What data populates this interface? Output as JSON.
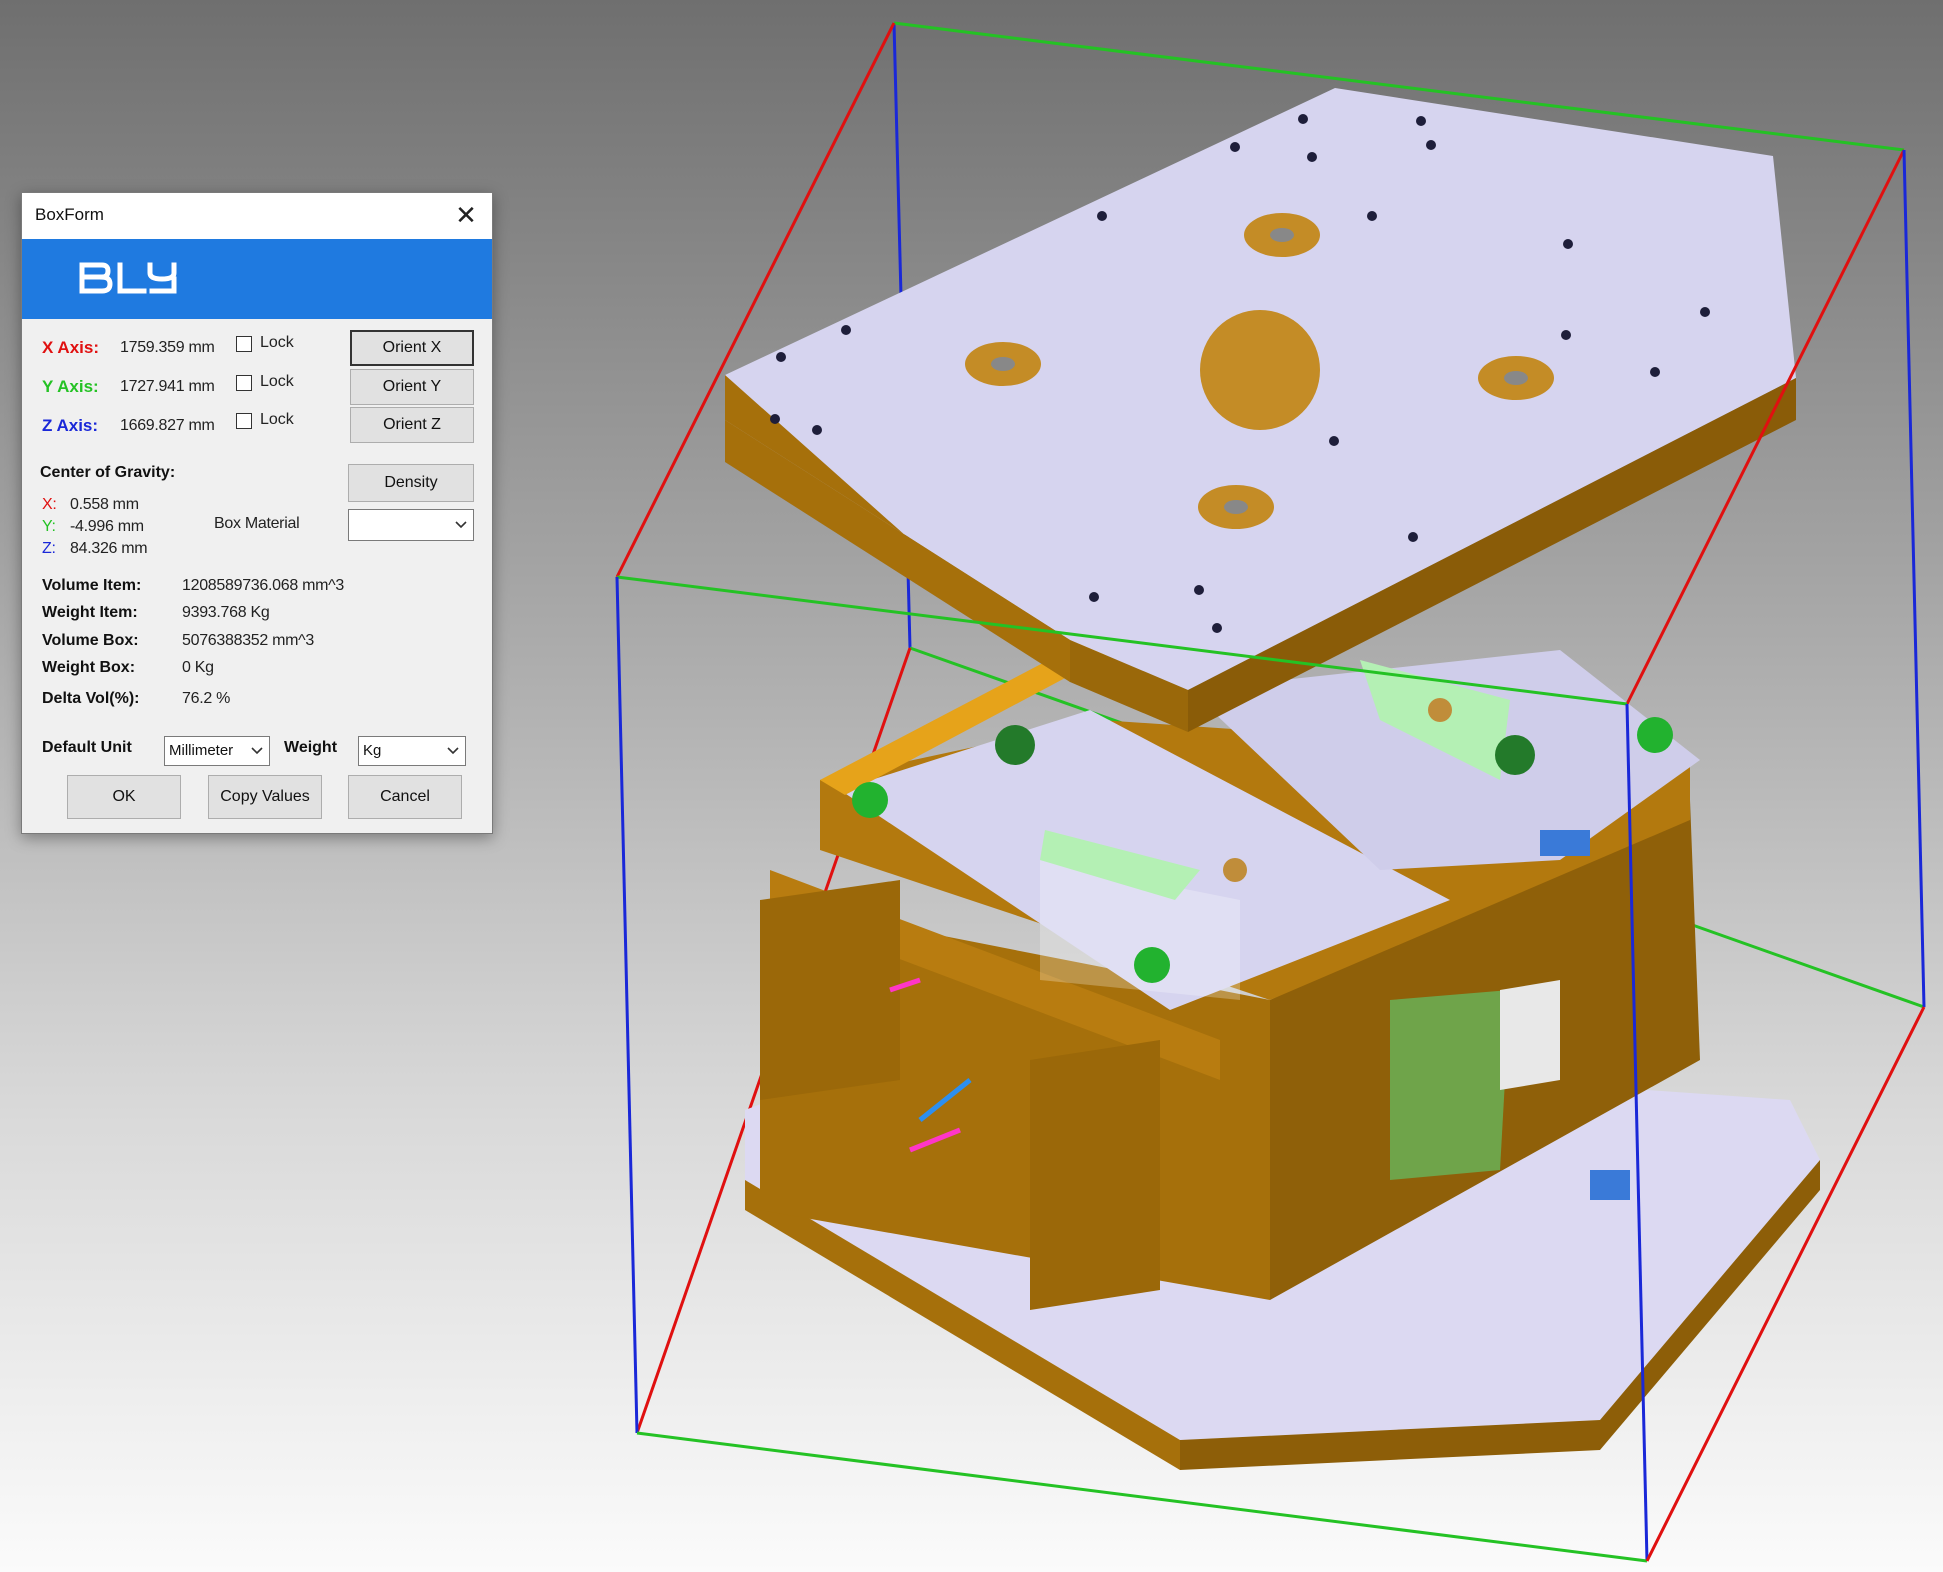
{
  "window": {
    "title": "BoxForm",
    "logo_text": "BLY"
  },
  "axes": [
    {
      "label": "X Axis:",
      "value": "1759.359 mm",
      "lock_label": "Lock",
      "orient_label": "Orient X",
      "color": "#e01010"
    },
    {
      "label": "Y Axis:",
      "value": "1727.941 mm",
      "lock_label": "Lock",
      "orient_label": "Orient Y",
      "color": "#24c224"
    },
    {
      "label": "Z Axis:",
      "value": "1669.827 mm",
      "lock_label": "Lock",
      "orient_label": "Orient Z",
      "color": "#1a28d8"
    }
  ],
  "gravity": {
    "title": "Center of Gravity:",
    "x_label": "X:",
    "x_value": "0.558 mm",
    "y_label": "Y:",
    "y_value": "-4.996 mm",
    "z_label": "Z:",
    "z_value": "84.326 mm"
  },
  "density_label": "Density",
  "box_material": {
    "label": "Box Material",
    "selected": ""
  },
  "stats": [
    {
      "label": "Volume Item:",
      "value": "1208589736.068 mm^3"
    },
    {
      "label": "Weight Item:",
      "value": "9393.768 Kg"
    },
    {
      "label": "Volume Box:",
      "value": "5076388352 mm^3"
    },
    {
      "label": "Weight Box:",
      "value": "0 Kg"
    },
    {
      "label": "Delta Vol(%):",
      "value": "76.2 %"
    }
  ],
  "units": {
    "default_label": "Default Unit",
    "default_selected": "Millimeter",
    "weight_label": "Weight",
    "weight_selected": "Kg"
  },
  "buttons": {
    "ok": "OK",
    "copy": "Copy Values",
    "cancel": "Cancel"
  },
  "colors": {
    "x_axis": "#e01010",
    "y_axis": "#24c224",
    "z_axis": "#1a28d8",
    "banner": "#1f7ae0",
    "plate": "#d6d4ef",
    "steel": "#a6700b"
  }
}
